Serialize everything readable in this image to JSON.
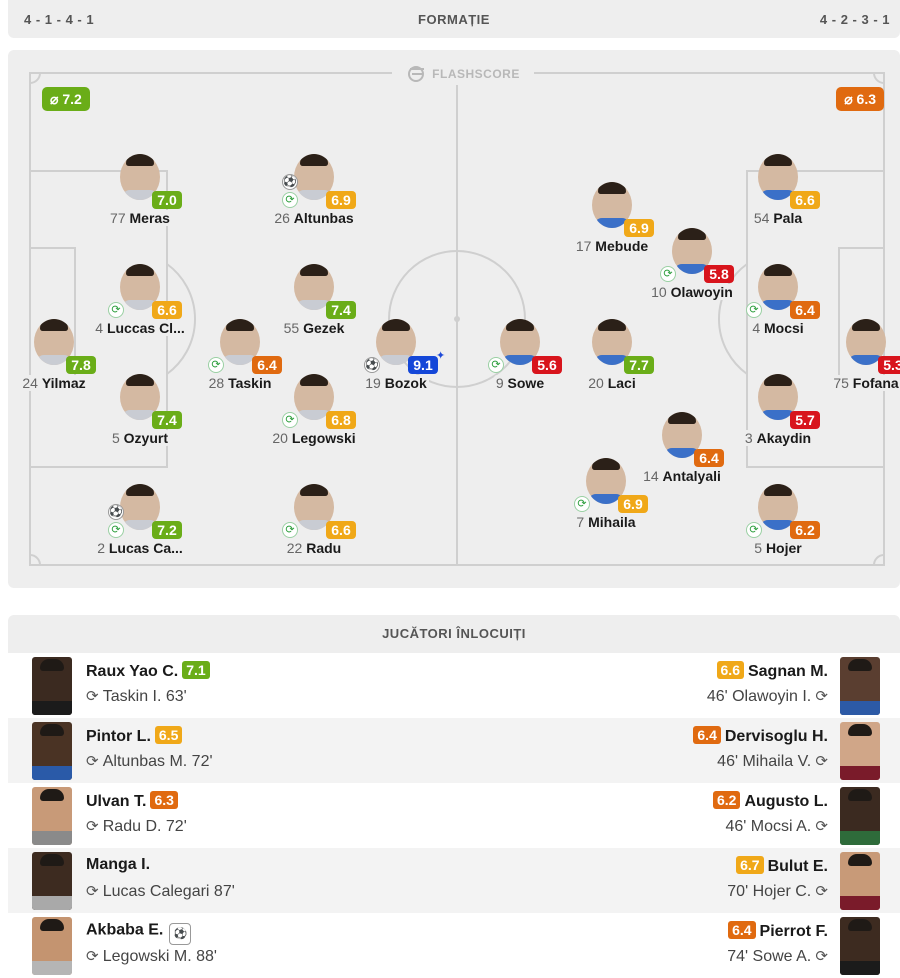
{
  "formation_bar": {
    "home": "4 - 1 - 4 - 1",
    "title": "FORMAȚIE",
    "away": "4 - 2 - 3 - 1"
  },
  "brand": "FLASHSCORE",
  "home_avg": "⌀ 7.2",
  "away_avg": "⌀ 6.3",
  "colors": {
    "good": "#6aad18",
    "mid": "#f0a818",
    "low": "#e06a10",
    "bad": "#d8141c",
    "best": "#1447d8"
  },
  "home_players": [
    {
      "num": "24",
      "name": "Yilmaz",
      "rating": "7.8",
      "tier": "good"
    },
    {
      "num": "77",
      "name": "Meras",
      "rating": "7.0",
      "tier": "good"
    },
    {
      "num": "4",
      "name": "Luccas Cl...",
      "rating": "6.6",
      "tier": "mid"
    },
    {
      "num": "5",
      "name": "Ozyurt",
      "rating": "7.4",
      "tier": "good"
    },
    {
      "num": "2",
      "name": "Lucas Ca...",
      "rating": "7.2",
      "tier": "good"
    },
    {
      "num": "28",
      "name": "Taskin",
      "rating": "6.4",
      "tier": "low"
    },
    {
      "num": "26",
      "name": "Altunbas",
      "rating": "6.9",
      "tier": "mid"
    },
    {
      "num": "55",
      "name": "Gezek",
      "rating": "7.4",
      "tier": "good"
    },
    {
      "num": "20",
      "name": "Legowski",
      "rating": "6.8",
      "tier": "mid"
    },
    {
      "num": "22",
      "name": "Radu",
      "rating": "6.6",
      "tier": "mid"
    },
    {
      "num": "19",
      "name": "Bozok",
      "rating": "9.1",
      "tier": "best"
    }
  ],
  "away_players": [
    {
      "num": "75",
      "name": "Fofana",
      "rating": "5.3",
      "tier": "bad"
    },
    {
      "num": "54",
      "name": "Pala",
      "rating": "6.6",
      "tier": "mid"
    },
    {
      "num": "4",
      "name": "Mocsi",
      "rating": "6.4",
      "tier": "low"
    },
    {
      "num": "3",
      "name": "Akaydin",
      "rating": "5.7",
      "tier": "bad"
    },
    {
      "num": "5",
      "name": "Hojer",
      "rating": "6.2",
      "tier": "low"
    },
    {
      "num": "10",
      "name": "Olawoyin",
      "rating": "5.8",
      "tier": "bad"
    },
    {
      "num": "14",
      "name": "Antalyali",
      "rating": "6.4",
      "tier": "low"
    },
    {
      "num": "17",
      "name": "Mebude",
      "rating": "6.9",
      "tier": "mid"
    },
    {
      "num": "20",
      "name": "Laci",
      "rating": "7.7",
      "tier": "good"
    },
    {
      "num": "7",
      "name": "Mihaila",
      "rating": "6.9",
      "tier": "mid"
    },
    {
      "num": "9",
      "name": "Sowe",
      "rating": "5.6",
      "tier": "bad"
    }
  ],
  "subs_title": "JUCĂTORI ÎNLOCUIȚI",
  "subs": [
    {
      "home_in": "Raux Yao C.",
      "home_rating": "7.1",
      "home_tier": "good",
      "home_out": "Taskin I. 63'",
      "away_in": "Sagnan M.",
      "away_rating": "6.6",
      "away_tier": "mid",
      "away_out": "46' Olawoyin I."
    },
    {
      "home_in": "Pintor L.",
      "home_rating": "6.5",
      "home_tier": "mid",
      "home_out": "Altunbas M. 72'",
      "away_in": "Dervisoglu H.",
      "away_rating": "6.4",
      "away_tier": "low",
      "away_out": "46' Mihaila V."
    },
    {
      "home_in": "Ulvan T.",
      "home_rating": "6.3",
      "home_tier": "low",
      "home_out": "Radu D. 72'",
      "away_in": "Augusto L.",
      "away_rating": "6.2",
      "away_tier": "low",
      "away_out": "46' Mocsi A."
    },
    {
      "home_in": "Manga I.",
      "home_rating": "",
      "home_tier": "",
      "home_out": "Lucas Calegari 87'",
      "away_in": "Bulut E.",
      "away_rating": "6.7",
      "away_tier": "mid",
      "away_out": "70' Hojer C."
    },
    {
      "home_in": "Akbaba E.",
      "home_rating": "",
      "home_tier": "",
      "home_out": "Legowski M. 88'",
      "away_in": "Pierrot F.",
      "away_rating": "6.4",
      "away_tier": "low",
      "away_out": "74' Sowe A."
    }
  ]
}
